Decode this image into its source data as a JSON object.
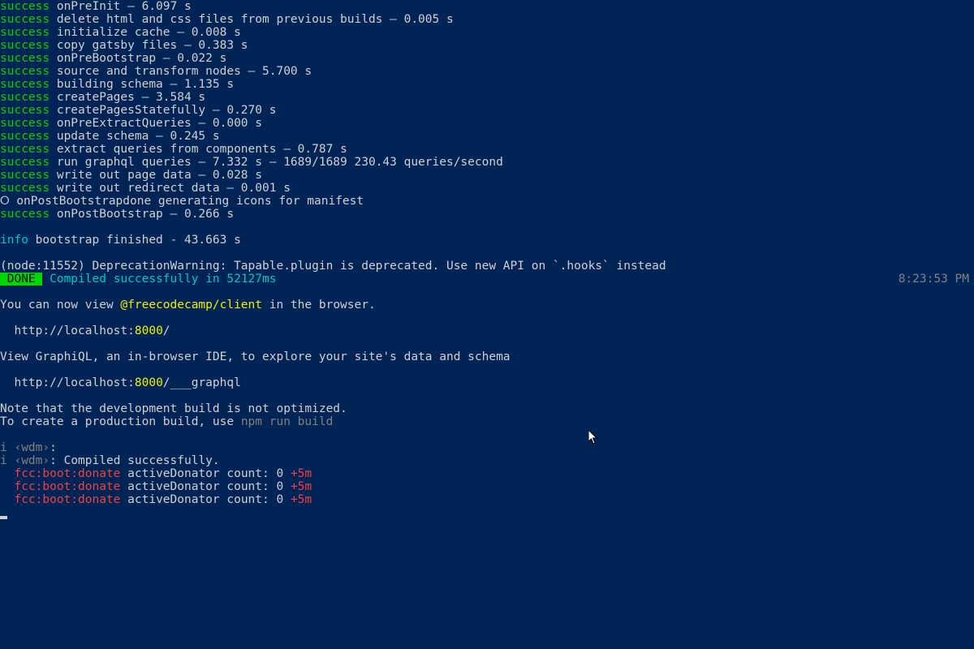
{
  "success_label": "success",
  "info_label": "info",
  "done_label": " DONE ",
  "done_text": " Compiled successfully in 52127ms",
  "done_time": "8:23:53 PM",
  "build_steps": [
    " onPreInit — 6.097 s",
    " delete html and css files from previous builds — 0.005 s",
    " initialize cache — 0.008 s",
    " copy gatsby files — 0.383 s",
    " onPreBootstrap — 0.022 s",
    " source and transform nodes — 5.700 s",
    " building schema — 1.135 s",
    " createPages — 3.584 s",
    " createPagesStatefully — 0.270 s",
    " onPreExtractQueries — 0.000 s",
    " update schema — 0.245 s",
    " extract queries from components — 0.787 s",
    " run graphql queries — 7.332 s — 1689/1689 230.43 queries/second",
    " write out page data — 0.028 s",
    " write out redirect data — 0.001 s"
  ],
  "manifest_line": "⭘ onPostBootstrapdone generating icons for manifest",
  "post_bootstrap_step": " onPostBootstrap — 0.266 s",
  "bootstrap_finished": " bootstrap finished - 43.663 s",
  "deprecation": "(node:11552) DeprecationWarning: Tapable.plugin is deprecated. Use new API on `.hooks` instead",
  "view_prefix": "You can now view ",
  "view_pkg": "@freecodecamp/client",
  "view_suffix": " in the browser.",
  "url1_a": "  http://localhost:",
  "url1_port": "8000",
  "url1_c": "/",
  "graphiql_hint": "View GraphiQL, an in-browser IDE, to explore your site's data and schema",
  "url2_a": "  http://localhost:",
  "url2_port": "8000",
  "url2_c": "/___graphql",
  "note1": "Note that the development build is not optimized.",
  "note2_a": "To create a production build, use ",
  "note2_cmd": "npm run build",
  "wdm_i": "i",
  "wdm_label": " ‹wdm›",
  "wdm1_tail": ":",
  "wdm2_tail": ": Compiled successfully.",
  "donate_label": "fcc:boot:donate",
  "donate_msg": " activeDonator count: 0 ",
  "donate_age": "+5m"
}
